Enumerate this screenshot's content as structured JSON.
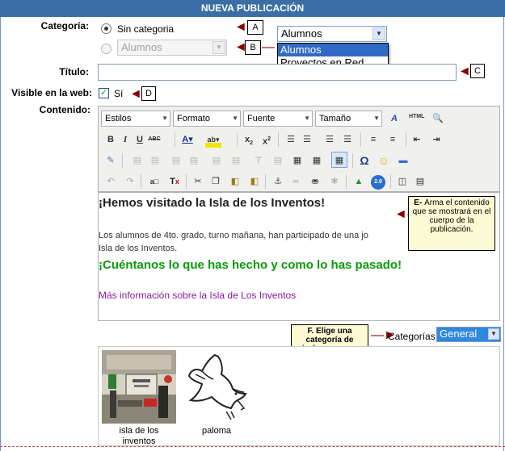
{
  "header": {
    "title": "NUEVA PUBLICACIÓN"
  },
  "categoria": {
    "label": "Categoría:",
    "option_none": "Sin categoria",
    "option_cat_value": "Alumnos",
    "open_select": {
      "value": "Alumnos",
      "options": [
        "Alumnos",
        "Proyectos en Red"
      ],
      "selected_index": 0
    }
  },
  "callouts": {
    "a": "A",
    "b": "B",
    "c": "C",
    "d": "D"
  },
  "titulo": {
    "label": "Título:",
    "value": ""
  },
  "visible": {
    "label": "Visible en la web:",
    "checked": true,
    "option": "Sí"
  },
  "contenido": {
    "label": "Contenido:",
    "toolbar": {
      "selects": [
        "Estilos",
        "Formato",
        "Fuente",
        "Tamaño"
      ],
      "html_label": "HTML"
    },
    "body": {
      "heading": "¡Hemos visitado la Isla de los Inventos!",
      "paragraph_line1": "Los alumnos de 4to. grado, turno mañana, han participado de una jo",
      "paragraph_line2": "Isla de los Inventos.",
      "green_heading": "¡Cuéntanos lo que has hecho y como lo has pasado!",
      "link_text": "Más información sobre la Isla de Los Inventos"
    },
    "callout_e": "E- Arma el contenido que se mostrará en el cuerpo de la publicación.",
    "callout_e_prefix": "E-",
    "callout_e_text": "Arma el contenido que se mostrará en el cuerpo de la publicación."
  },
  "imagenes": {
    "callout_f_prefix": "F.",
    "callout_f_text": "Elige una categoría de imágenes y se listarán para su incrustación.",
    "categorias_label": "Categorías",
    "categorias_value": "General",
    "items": [
      {
        "caption": "isla de los inventos"
      },
      {
        "caption": "paloma"
      }
    ]
  },
  "colors": {
    "header_bg": "#3a6ea5",
    "callout_arrow": "#8b0000",
    "accent_select": "#316ac5",
    "green_text": "#0a9b0a",
    "purple_text": "#8a1c9e"
  }
}
